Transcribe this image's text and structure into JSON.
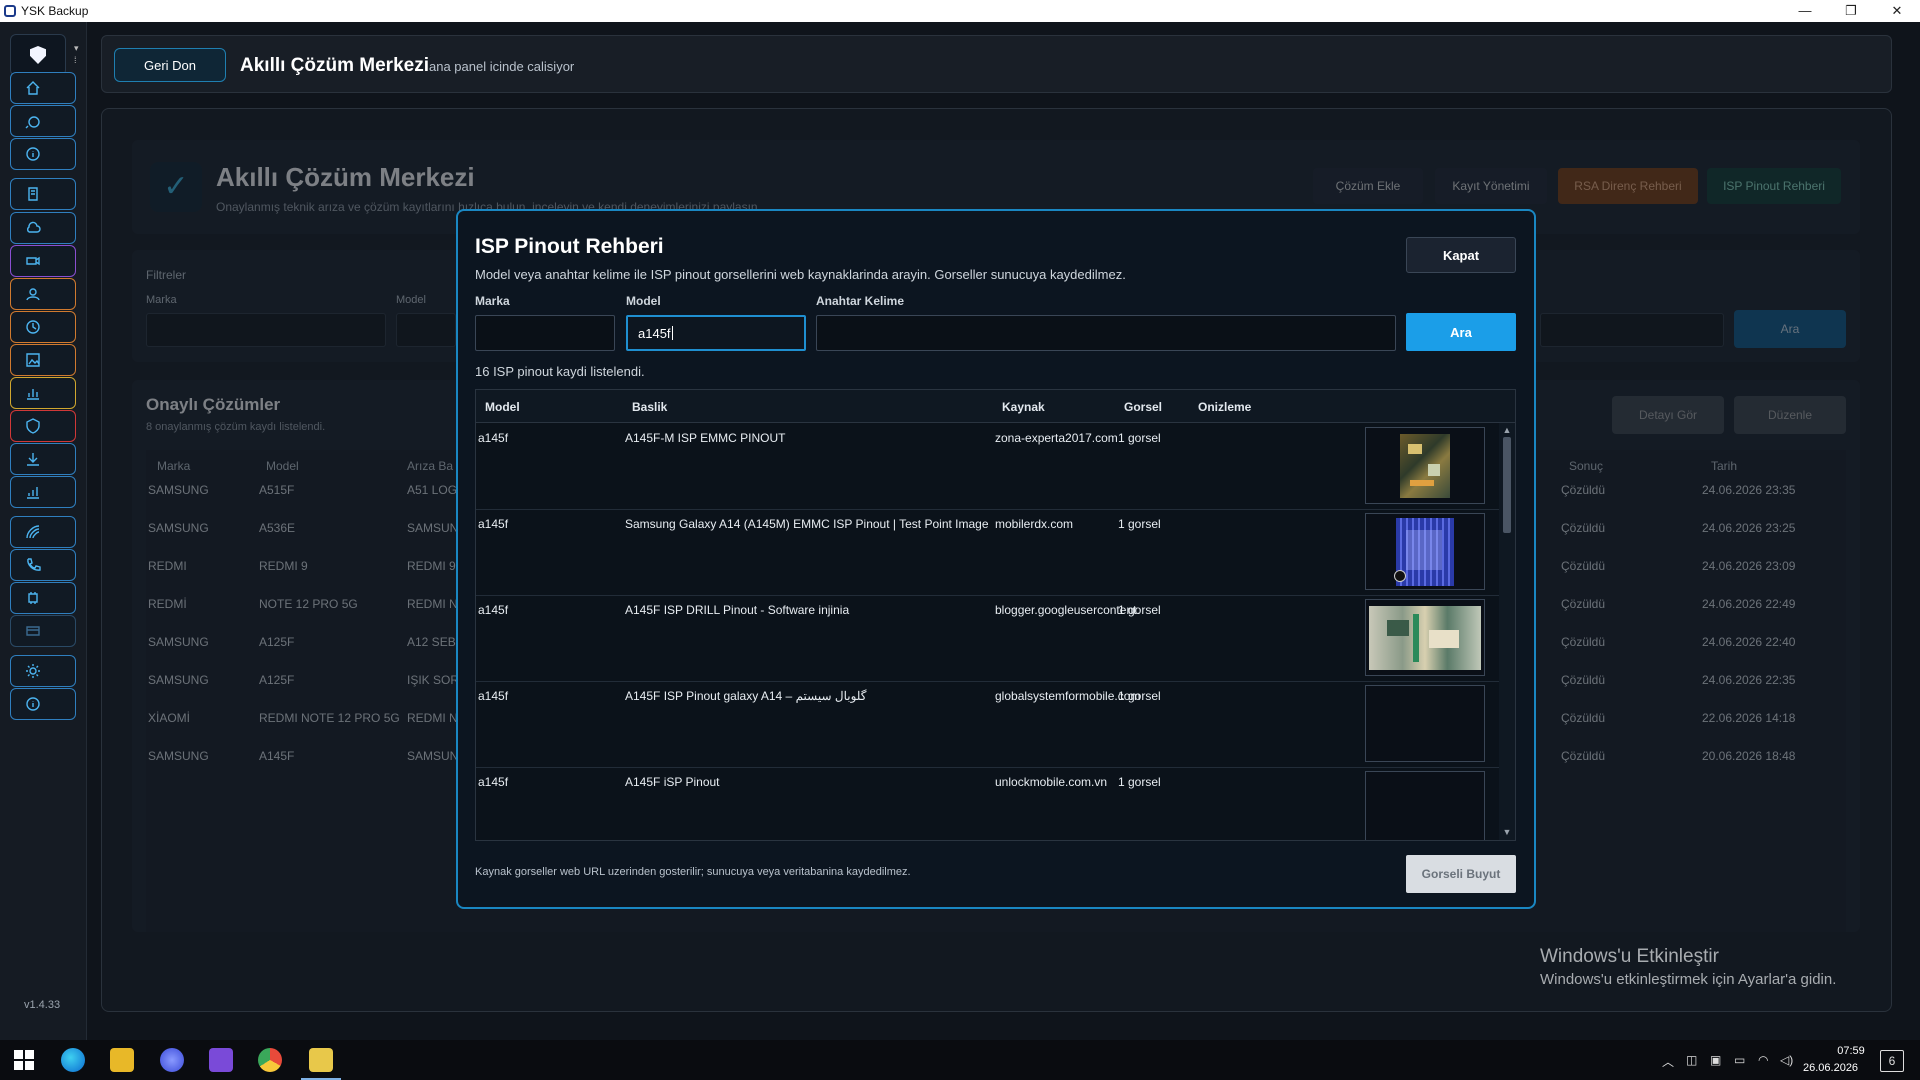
{
  "window": {
    "title": "YSK Backup",
    "controls": [
      "—",
      "❐",
      "✕"
    ]
  },
  "sidebar": {
    "version": "v1.4.33",
    "nav_items": [
      {
        "icon": "home-icon",
        "color": "#2f7fbf"
      },
      {
        "icon": "search-icon",
        "color": "#2f7fbf"
      },
      {
        "icon": "info-icon",
        "color": "#2f7fbf"
      },
      {
        "icon": "document-icon",
        "color": "#2f7fbf"
      },
      {
        "icon": "cloud-icon",
        "color": "#2f7fbf"
      },
      {
        "icon": "video-icon",
        "color": "#8a4fd1"
      },
      {
        "icon": "user-icon",
        "color": "#d07a2f"
      },
      {
        "icon": "history-icon",
        "color": "#d07a2f"
      },
      {
        "icon": "image-icon",
        "color": "#d07a2f"
      },
      {
        "icon": "chart-icon",
        "color": "#d0a72f"
      },
      {
        "icon": "shield-icon",
        "color": "#d03838"
      },
      {
        "icon": "download-icon",
        "color": "#2f7fbf"
      },
      {
        "icon": "stats-icon",
        "color": "#2f7fbf"
      },
      {
        "icon": "signal-icon",
        "color": "#2f7fbf"
      },
      {
        "icon": "phone-icon",
        "color": "#2f7fbf"
      },
      {
        "icon": "chip-icon",
        "color": "#2f7fbf"
      },
      {
        "icon": "card-icon",
        "color": "#2a4a66"
      },
      {
        "icon": "gear-icon",
        "color": "#2f7fbf"
      },
      {
        "icon": "about-icon",
        "color": "#2f7fbf"
      }
    ]
  },
  "header": {
    "back_label": "Geri Don",
    "title": "Akıllı Çözüm Merkezi",
    "subtitle": "ana panel icinde calisiyor"
  },
  "background_page": {
    "title": "Akıllı Çözüm Merkezi",
    "subtitle": "Onaylanmış teknik arıza ve çözüm kayıtlarını hızlıca bulun, inceleyin ve kendi deneyimlerinizi paylaşın.",
    "buttons": [
      "Çözüm Ekle",
      "Kayıt Yönetimi",
      "RSA Direnç Rehberi",
      "ISP Pinout Rehberi"
    ],
    "filters_label": "Filtreler",
    "filter_fields": [
      "Marka",
      "Model"
    ],
    "search_label": "Ara",
    "section_title": "Onaylı Çözümler",
    "section_sub": "8 onaylanmış çözüm kaydı listelendi.",
    "detail_btn": "Detayı Gör",
    "edit_btn": "Düzenle",
    "columns": [
      "Marka",
      "Model",
      "Arıza Ba",
      "Sonuç",
      "Tarih"
    ],
    "rows": [
      {
        "brand": "SAMSUNG",
        "model": "A515F",
        "fault": "A51 LOGO",
        "result": "Çözüldü",
        "date": "24.06.2026 23:35"
      },
      {
        "brand": "SAMSUNG",
        "model": "A536E",
        "fault": "SAMSUNG",
        "result": "Çözüldü",
        "date": "24.06.2026 23:25"
      },
      {
        "brand": "REDMI",
        "model": "REDMI 9",
        "fault": "REDMI 9 L",
        "result": "Çözüldü",
        "date": "24.06.2026 23:09"
      },
      {
        "brand": "REDMİ",
        "model": "NOTE 12 PRO 5G",
        "fault": "REDMI NO",
        "result": "Çözüldü",
        "date": "24.06.2026 22:49"
      },
      {
        "brand": "SAMSUNG",
        "model": "A125F",
        "fault": "A12 SEBEK",
        "result": "Çözüldü",
        "date": "24.06.2026 22:40"
      },
      {
        "brand": "SAMSUNG",
        "model": "A125F",
        "fault": "IŞIK SORU",
        "result": "Çözüldü",
        "date": "24.06.2026 22:35"
      },
      {
        "brand": "XİAOMİ",
        "model": "REDMI NOTE 12 PRO 5G",
        "fault": "REDMI NO",
        "result": "Çözüldü",
        "date": "22.06.2026 14:18"
      },
      {
        "brand": "SAMSUNG",
        "model": "A145F",
        "fault": "SAMSUNG",
        "result": "Çözüldü",
        "date": "20.06.2026 18:48"
      }
    ]
  },
  "modal": {
    "title": "ISP Pinout Rehberi",
    "description": "Model veya anahtar kelime ile ISP pinout gorsellerini web kaynaklarinda arayin. Gorseller sunucuya kaydedilmez.",
    "close_label": "Kapat",
    "brand_label": "Marka",
    "brand_value": "",
    "model_label": "Model",
    "model_value": "a145f",
    "keyword_label": "Anahtar Kelime",
    "keyword_value": "",
    "search_label": "Ara",
    "result_count": "16 ISP pinout kaydi listelendi.",
    "columns": {
      "model": "Model",
      "title": "Baslik",
      "source": "Kaynak",
      "images": "Gorsel",
      "preview": "Onizleme"
    },
    "results": [
      {
        "model": "a145f",
        "title": "A145F-M ISP EMMC PINOUT",
        "source": "zona-experta2017.com",
        "images": "1 gorsel",
        "thumb": "board-small"
      },
      {
        "model": "a145f",
        "title": "Samsung Galaxy A14 (A145M) EMMC ISP Pinout | Test Point Image",
        "source": "mobilerdx.com",
        "images": "1 gorsel",
        "thumb": "board-blue"
      },
      {
        "model": "a145f",
        "title": "A145F ISP DRILL Pinout - Software injinia",
        "source": "blogger.googleusercontent.",
        "images": "1 gorsel",
        "thumb": "board-wide"
      },
      {
        "model": "a145f",
        "title": "A145F ISP Pinout galaxy A14 – گلوبال سیستم",
        "source": "globalsystemformobile.com",
        "images": "1 gorsel",
        "thumb": "empty"
      },
      {
        "model": "a145f",
        "title": "A145F iSP Pinout",
        "source": "unlockmobile.com.vn",
        "images": "1 gorsel",
        "thumb": "empty"
      }
    ],
    "footer_note": "Kaynak gorseller web URL uzerinden gosterilir; sunucuya veya veritabanina kaydedilmez.",
    "enlarge_label": "Gorseli Buyut"
  },
  "watermark": {
    "title": "Windows'u Etkinleştir",
    "subtitle": "Windows'u etkinleştirmek için Ayarlar'a gidin."
  },
  "taskbar": {
    "time": "07:59",
    "date": "26.06.2026",
    "notification_count": "6",
    "apps": [
      "start-icon",
      "edge-icon",
      "explorer-icon",
      "messenger-icon",
      "visual-studio-icon",
      "chrome-icon",
      "ysk-backup-icon"
    ]
  }
}
